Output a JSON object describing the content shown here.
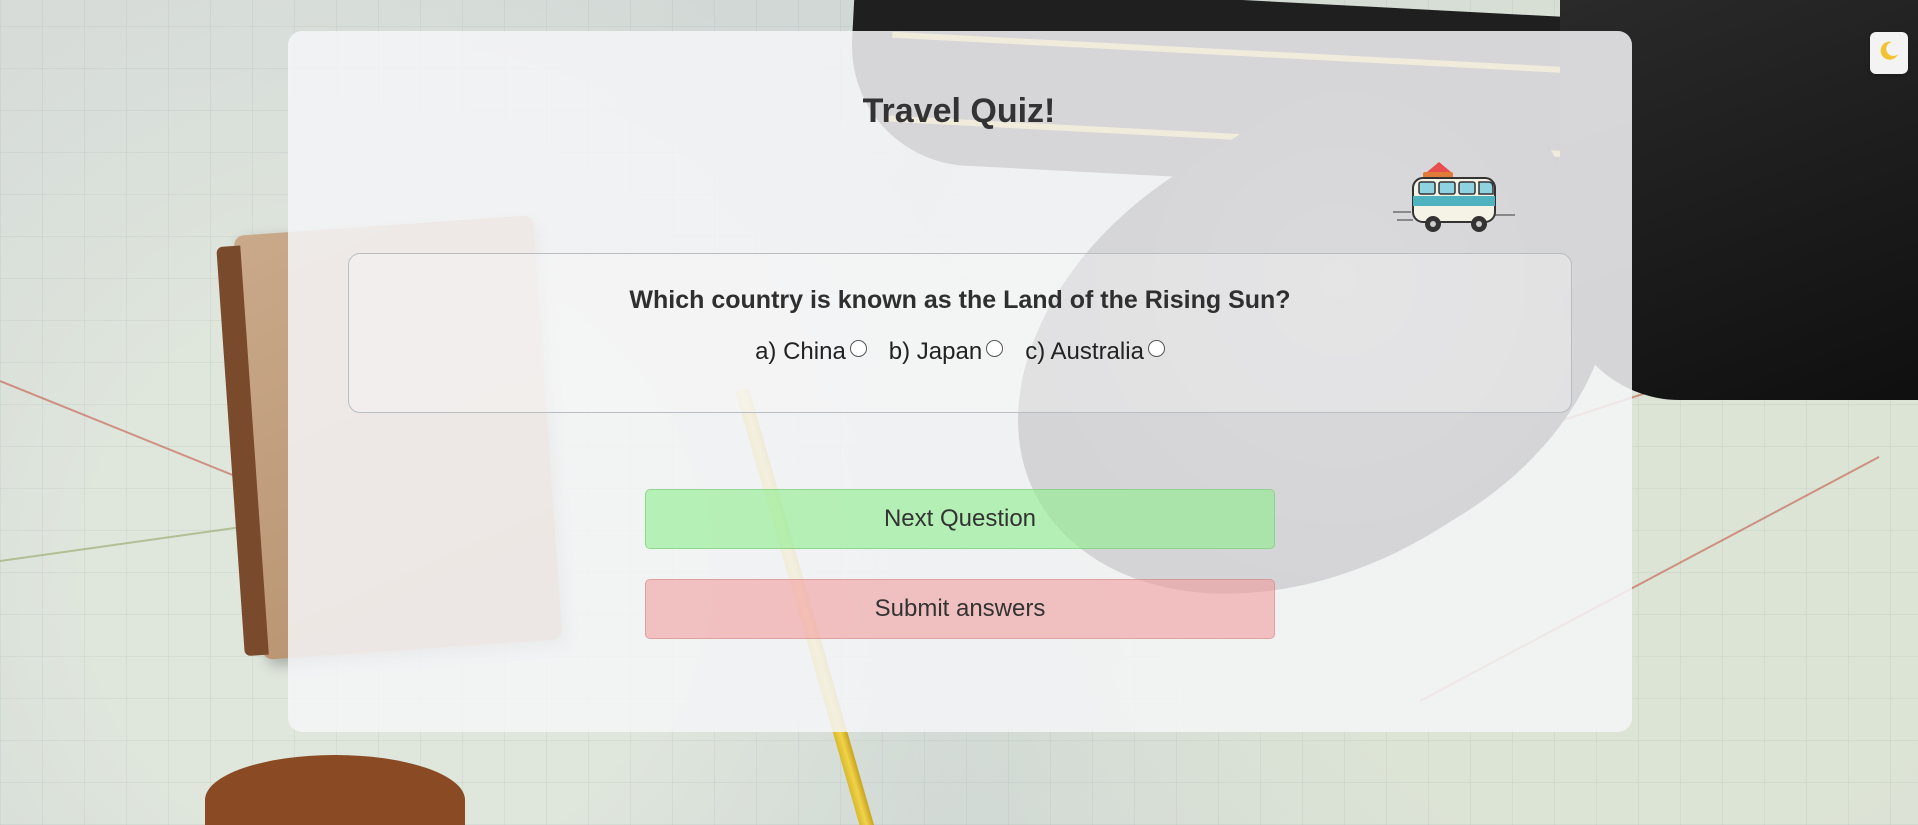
{
  "page": {
    "title": "Travel Quiz!"
  },
  "quiz": {
    "question": "Which country is known as the Land of the Rising Sun?",
    "options": [
      {
        "label": "a) China"
      },
      {
        "label": "b) Japan"
      },
      {
        "label": "c) Australia"
      }
    ]
  },
  "buttons": {
    "next_label": "Next Question",
    "submit_label": "Submit answers"
  },
  "colors": {
    "next_button": "#90ee90",
    "submit_button": "#f09696",
    "panel": "#f4f5f7"
  },
  "icons": {
    "theme_toggle": "moon-icon",
    "mascot": "camper-van-icon"
  }
}
